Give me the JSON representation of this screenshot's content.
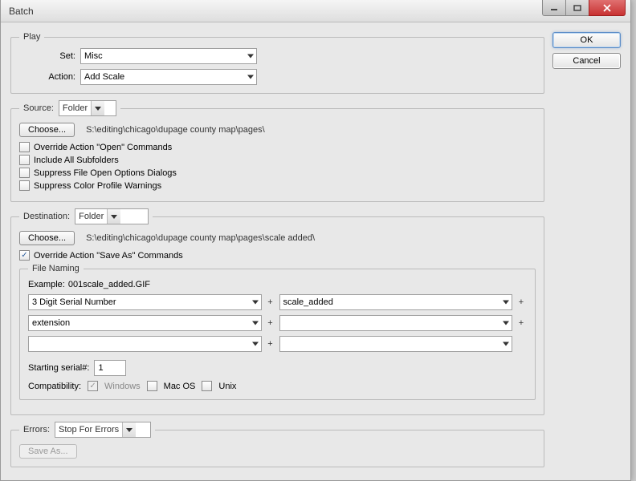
{
  "window": {
    "title": "Batch"
  },
  "buttons": {
    "ok": "OK",
    "cancel": "Cancel",
    "choose": "Choose...",
    "save_as": "Save As..."
  },
  "play": {
    "legend": "Play",
    "set_label": "Set:",
    "set_value": "Misc",
    "action_label": "Action:",
    "action_value": "Add Scale"
  },
  "source": {
    "label": "Source:",
    "value": "Folder",
    "path": "S:\\editing\\chicago\\dupage county map\\pages\\",
    "opts": {
      "override_open": "Override Action \"Open\" Commands",
      "include_subfolders": "Include All Subfolders",
      "suppress_open_dialogs": "Suppress File Open Options Dialogs",
      "suppress_color_warnings": "Suppress Color Profile Warnings"
    }
  },
  "destination": {
    "label": "Destination:",
    "value": "Folder",
    "path": "S:\\editing\\chicago\\dupage county map\\pages\\scale added\\",
    "override_saveas": "Override Action \"Save As\" Commands"
  },
  "file_naming": {
    "legend": "File Naming",
    "example_label": "Example:",
    "example_value": "001scale_added.GIF",
    "fields": [
      "3 Digit Serial Number",
      "scale_added",
      "extension",
      "",
      "",
      ""
    ],
    "starting_label": "Starting serial#:",
    "starting_value": "1",
    "compat_label": "Compatibility:",
    "compat": {
      "windows": "Windows",
      "mac": "Mac OS",
      "unix": "Unix"
    }
  },
  "errors": {
    "label": "Errors:",
    "value": "Stop For Errors"
  }
}
